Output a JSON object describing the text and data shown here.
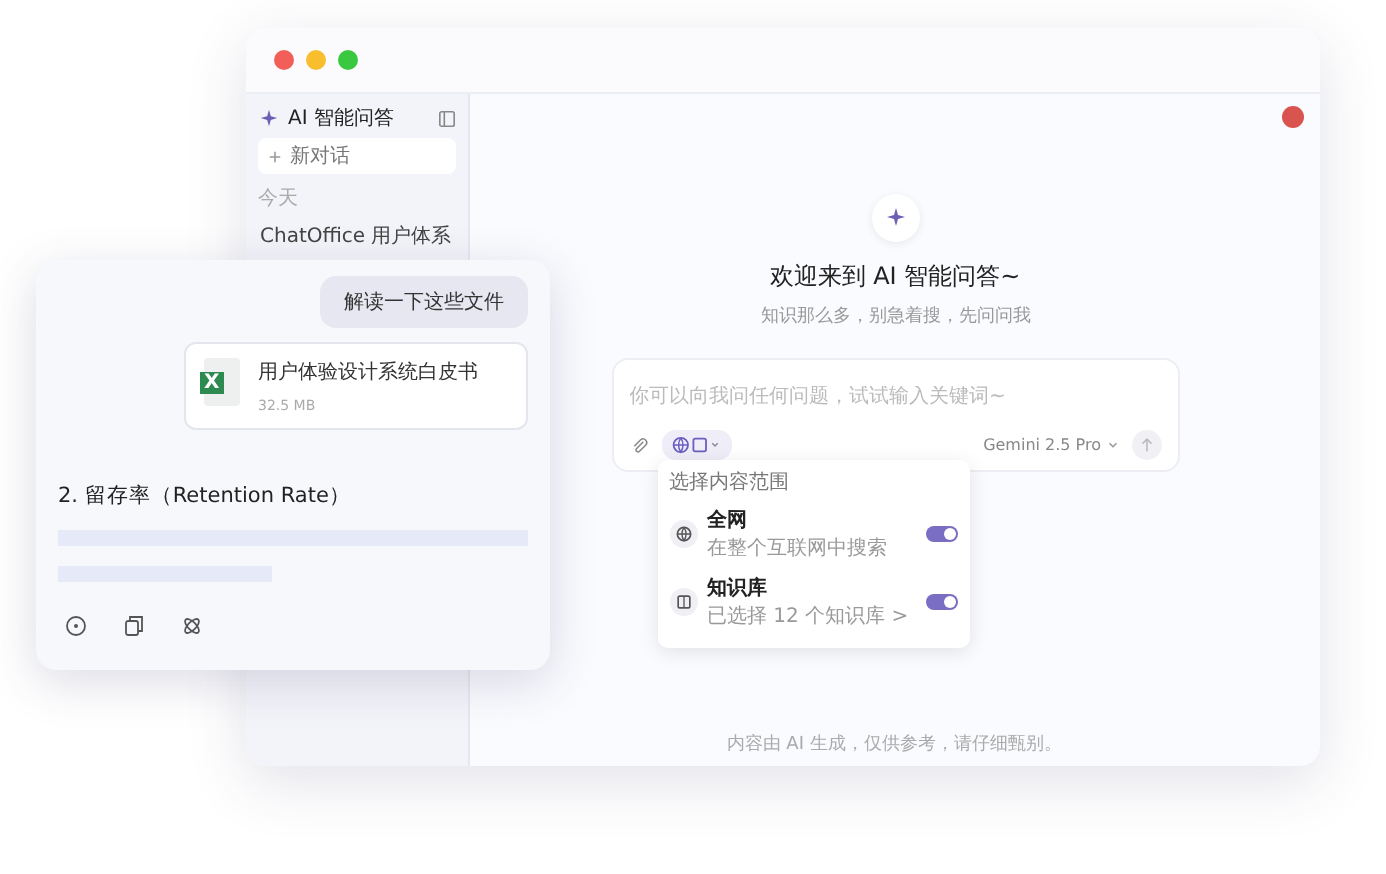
{
  "sidebar": {
    "title": "AI 智能问答",
    "new_chat": "新对话",
    "section": "今天",
    "items": [
      {
        "label": "ChatOffice 用户体系",
        "selected": false
      }
    ]
  },
  "main": {
    "welcome_title": "欢迎来到 AI 智能问答~",
    "welcome_subtitle": "知识那么多，别急着搜，先问问我",
    "input": {
      "placeholder": "你可以向我问任何问题，试试输入关键词~"
    },
    "model": "Gemini 2.5 Pro",
    "scope_menu": {
      "title": "选择内容范围",
      "options": [
        {
          "kind": "web",
          "name": "全网",
          "description": "在整个互联网中搜索",
          "on": true
        },
        {
          "kind": "knowledge",
          "name": "知识库",
          "description": "已选择 12 个知识库 >",
          "on": true
        }
      ]
    },
    "footer": "内容由 AI 生成，仅供参考，请仔细甄别。"
  },
  "chat_card": {
    "user_message": "解读一下这些文件",
    "file": {
      "icon_letter": "X",
      "name": "用户体验设计系统白皮书",
      "size": "32.5 MB"
    },
    "heading": "2. 留存率（Retention Rate）"
  }
}
